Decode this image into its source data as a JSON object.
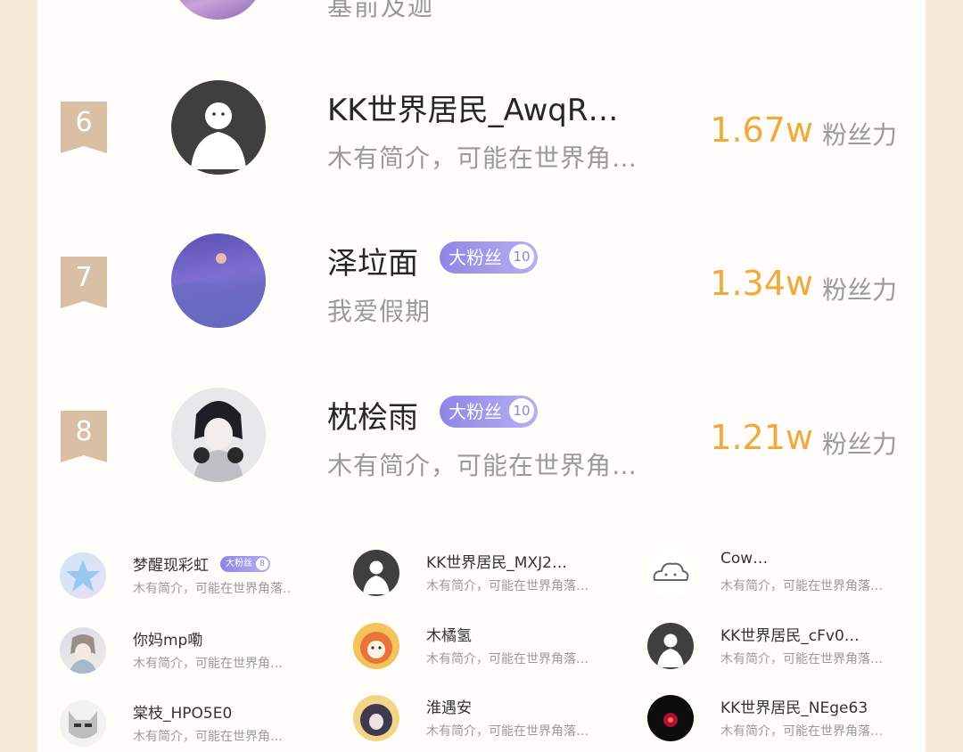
{
  "top_partial": {
    "bio": "基前及迦"
  },
  "ranked": [
    {
      "rank": "6",
      "name": "KK世界居民_AwqR…",
      "bio": "木有简介，可能在世界角…",
      "score": "1.67w",
      "unit": "粉丝力"
    },
    {
      "rank": "7",
      "name": "泽垃面",
      "badge": "大粉丝",
      "badge_level": "10",
      "bio": "我爱假期",
      "score": "1.34w",
      "unit": "粉丝力"
    },
    {
      "rank": "8",
      "name": "枕桧雨",
      "badge": "大粉丝",
      "badge_level": "10",
      "bio": "木有简介，可能在世界角…",
      "score": "1.21w",
      "unit": "粉丝力"
    }
  ],
  "grid": [
    {
      "name": "梦醒现彩虹",
      "badge": "大粉丝",
      "badge_level": "8",
      "bio": "木有简介，可能在世界角落.."
    },
    {
      "name": "KK世界居民_MXJ2…",
      "bio": "木有简介，可能在世界角落…"
    },
    {
      "name": "Cow…",
      "bio": "木有简介，可能在世界角落…"
    },
    {
      "name": "你妈mp嘞",
      "bio": "木有简介，可能在世界角…"
    },
    {
      "name": "木橘氢",
      "bio": "木有简介，可能在世界角落…"
    },
    {
      "name": "KK世界居民_cFv0…",
      "bio": "木有简介，可能在世界角落…"
    },
    {
      "name": "棠枝_HPO5E0",
      "bio": "木有简介，可能在世界角…"
    },
    {
      "name": "淮遇安",
      "bio": "木有简介，可能在世界角落…"
    },
    {
      "name": "KK世界居民_NEge63",
      "bio": "木有简介，可能在世界角落…"
    }
  ],
  "colors": {
    "score": "#f0a93a",
    "rank_badge": "#d9bfa4",
    "fan_badge": "#9c95ea",
    "page_bg": "#f7ead8"
  }
}
